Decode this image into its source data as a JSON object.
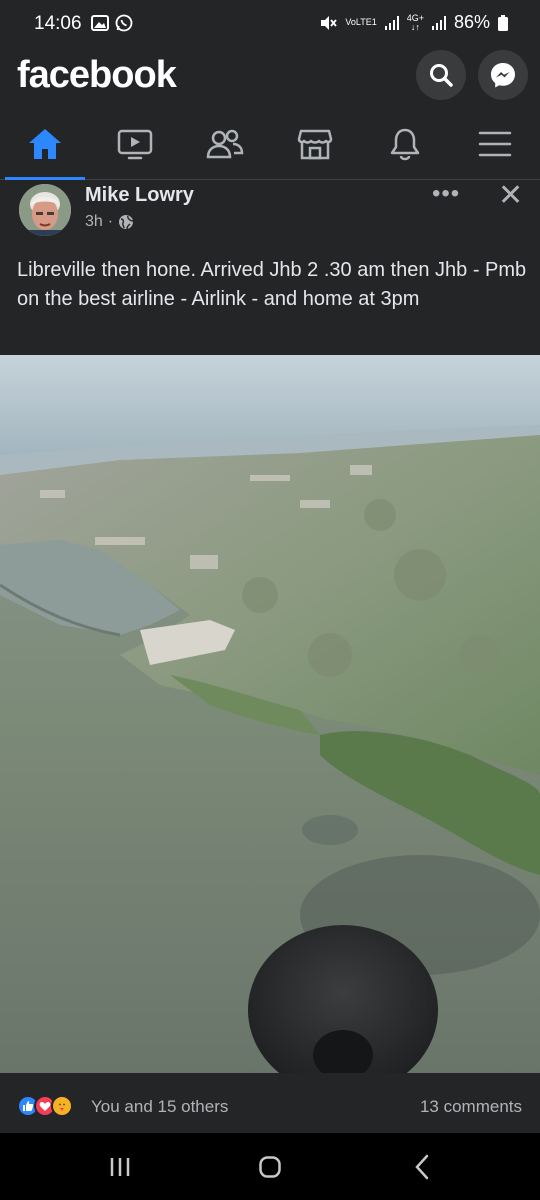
{
  "status_bar": {
    "time": "14:06",
    "network_label": "4G+",
    "volte_label": "VoLTE1",
    "battery": "86%"
  },
  "header": {
    "app_name": "facebook",
    "search_icon": "search-icon",
    "messenger_icon": "messenger-icon"
  },
  "nav": {
    "items": [
      "home-icon",
      "video-icon",
      "friends-icon",
      "marketplace-icon",
      "notifications-icon",
      "menu-icon"
    ],
    "active": "home-icon"
  },
  "post": {
    "author": "Mike Lowry",
    "time": "3h",
    "audience_icon": "globe-icon",
    "more_label": "•••",
    "close_label": "✕",
    "text": "Libreville then hone. Arrived Jhb 2 .30 am then Jhb - Pmb on the best airline - Airlink - and home at 3pm",
    "photo_icon": "aerial-photo"
  },
  "reactions": {
    "icons": [
      "like-icon",
      "love-icon",
      "care-icon"
    ],
    "summary": "You and 15 others",
    "comments": "13 comments"
  },
  "system_nav": {
    "items": [
      "recents-icon",
      "home-button-icon",
      "back-icon"
    ]
  },
  "colors": {
    "background": "#242526",
    "accent": "#2d88ff",
    "text": "#e4e6eb",
    "secondary_text": "#b0b3b8"
  }
}
